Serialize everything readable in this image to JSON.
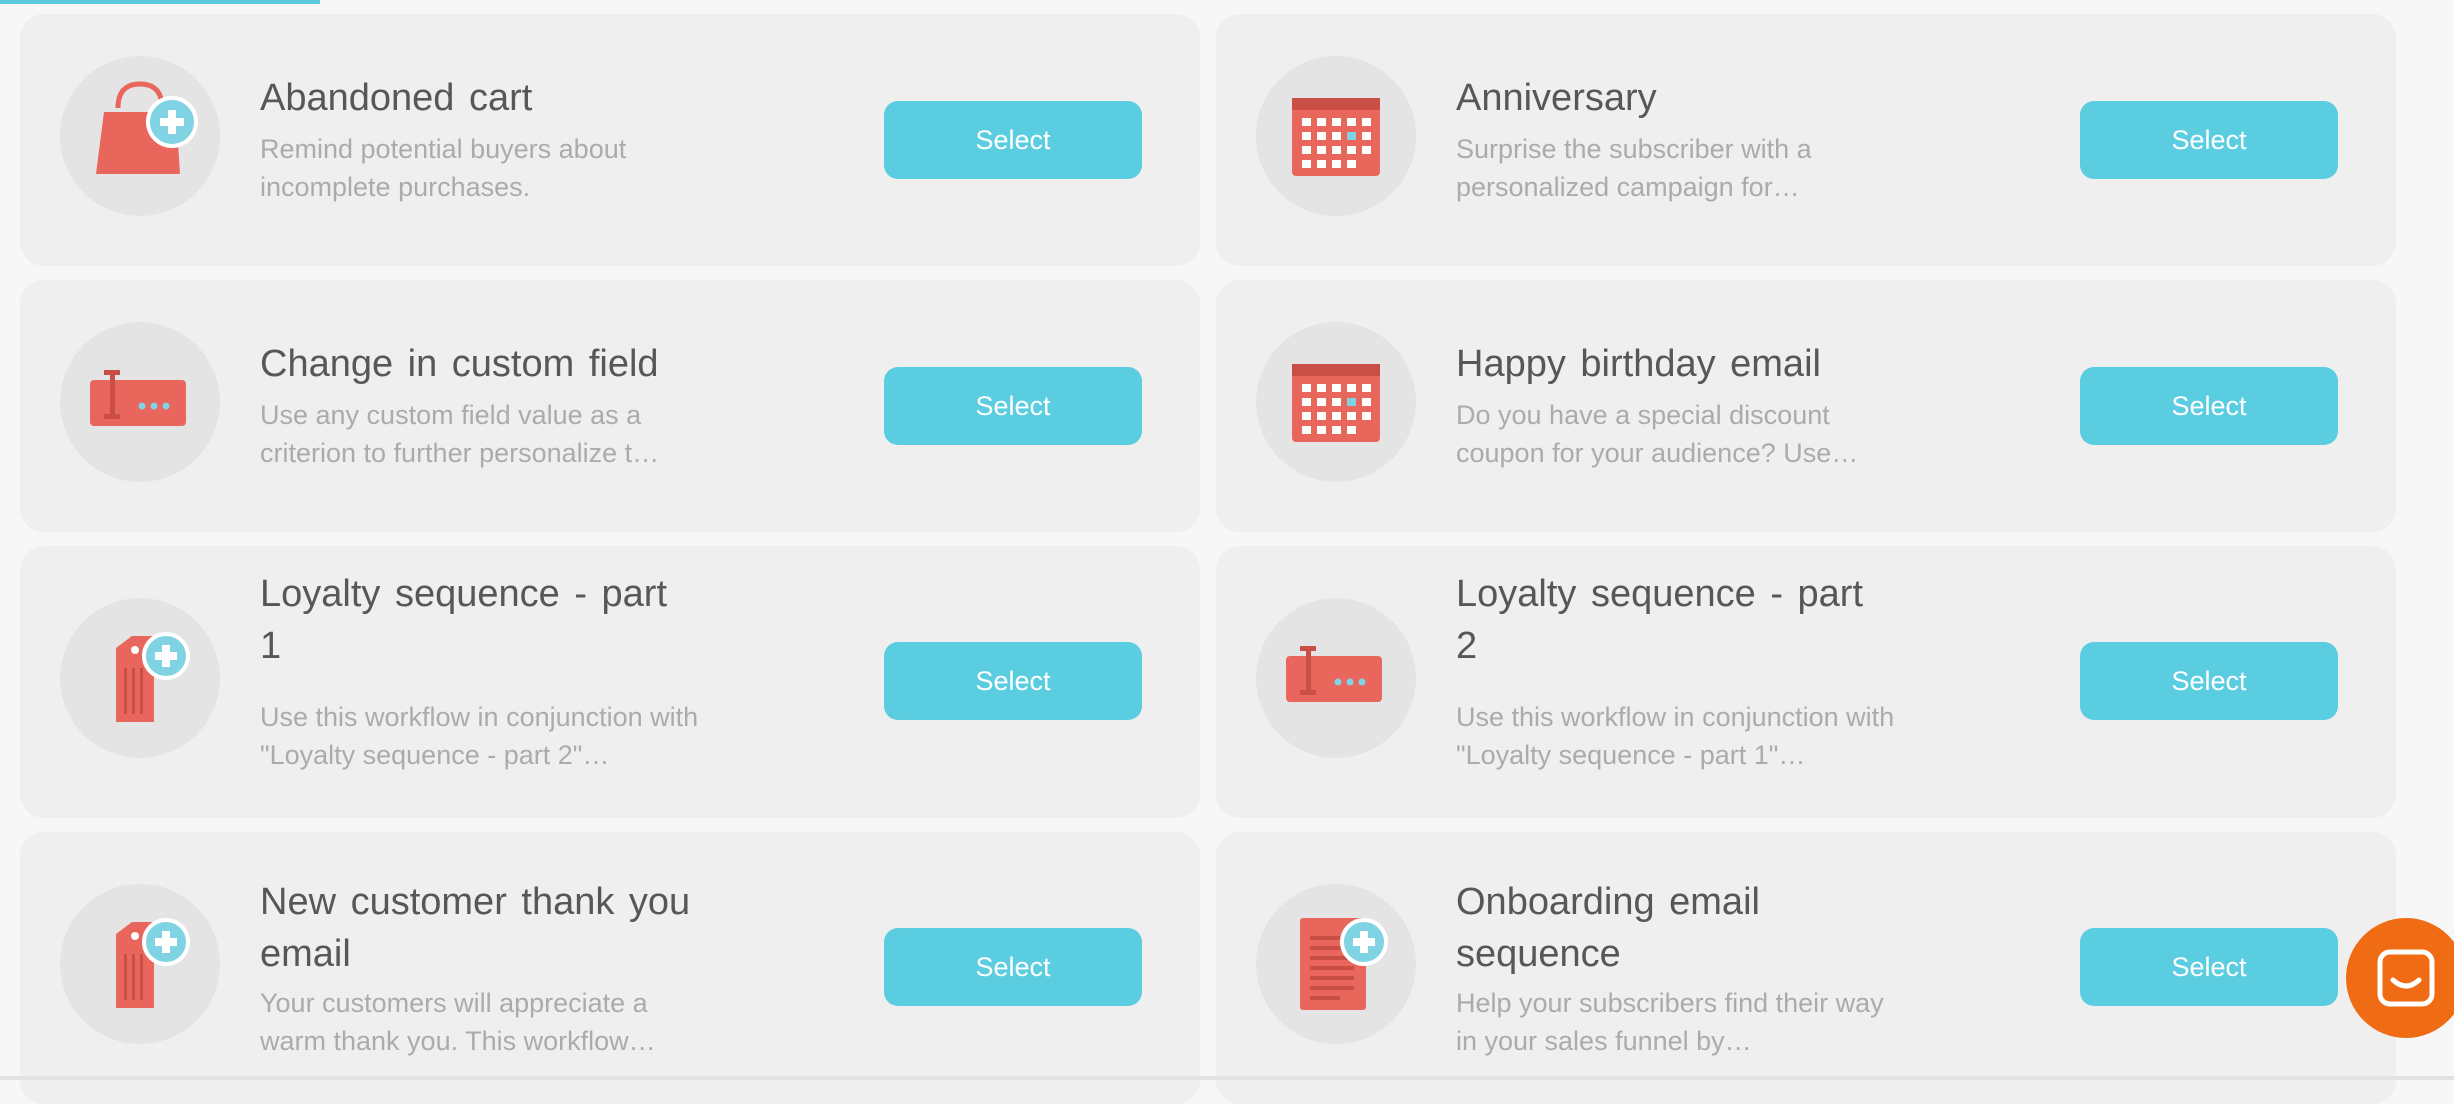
{
  "colors": {
    "card_background": "#efefef",
    "icon_circle": "#e4e4e4",
    "icon_red": "#e9665c",
    "icon_plus_circle": "#7fd3e3",
    "button": "#5bcde0",
    "title_text": "#575757",
    "description_text": "#ababab",
    "chat_button": "#ef6b14",
    "progress_accent": "#5bc9de"
  },
  "workflows": [
    {
      "icon": "shopping-bag-plus-icon",
      "title": "Abandoned cart",
      "description": "Remind potential buyers about incomplete purchases.",
      "button_label": "Select"
    },
    {
      "icon": "calendar-icon",
      "title": "Anniversary",
      "description": "Surprise the subscriber with a personalized campaign for…",
      "button_label": "Select"
    },
    {
      "icon": "custom-field-icon",
      "title": "Change in custom field",
      "description": "Use any custom field value as a criterion to further personalize t…",
      "button_label": "Select"
    },
    {
      "icon": "calendar-icon",
      "title": "Happy birthday email",
      "description": "Do you have a special discount coupon for your audience? Use…",
      "button_label": "Select"
    },
    {
      "icon": "tag-plus-icon",
      "title": "Loyalty sequence - part 1",
      "description": "Use this workflow in conjunction with \"Loyalty sequence - part 2\"…",
      "button_label": "Select"
    },
    {
      "icon": "custom-field-icon",
      "title": "Loyalty sequence - part 2",
      "description": "Use this workflow in conjunction with \"Loyalty sequence - part 1\"…",
      "button_label": "Select"
    },
    {
      "icon": "tag-plus-icon",
      "title": "New customer thank you email",
      "description": "Your customers will appreciate a warm thank you. This workflow…",
      "button_label": "Select"
    },
    {
      "icon": "document-plus-icon",
      "title": "Onboarding email sequence",
      "description": "Help your subscribers find their way in your sales funnel by…",
      "button_label": "Select"
    }
  ],
  "chat_widget": {
    "icon": "chat-bubble-icon"
  }
}
